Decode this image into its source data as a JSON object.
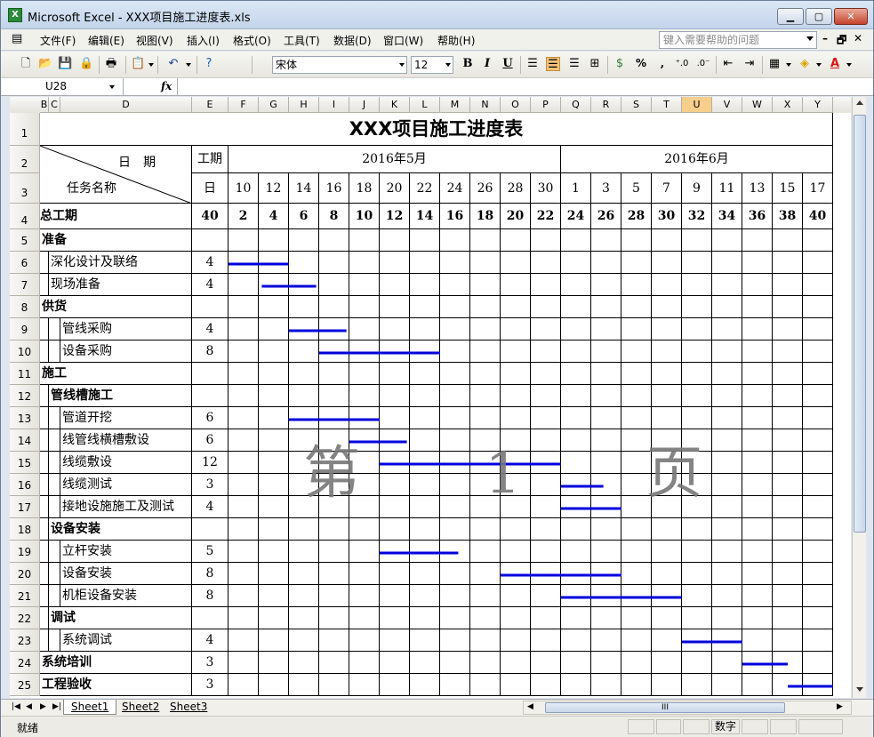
{
  "window": {
    "app_icon": "excel-icon",
    "title": "Microsoft Excel - XXX项目施工进度表.xls"
  },
  "menu": {
    "items": [
      "文件(F)",
      "编辑(E)",
      "视图(V)",
      "插入(I)",
      "格式(O)",
      "工具(T)",
      "数据(D)",
      "窗口(W)",
      "帮助(H)"
    ],
    "help_placeholder": "键入需要帮助的问题"
  },
  "toolbar": {
    "font_name": "宋体",
    "font_size": "12",
    "bold_label": "B",
    "italic_label": "I",
    "underline_label": "U",
    "percent_label": "%",
    "comma_label": ","
  },
  "formula_bar": {
    "cell_ref": "U28",
    "fx_label": "fx",
    "content": ""
  },
  "columns": [
    "B",
    "C",
    "D",
    "E",
    "F",
    "G",
    "H",
    "I",
    "J",
    "K",
    "L",
    "M",
    "N",
    "O",
    "P",
    "Q",
    "R",
    "S",
    "T",
    "U",
    "V",
    "W",
    "X",
    "Y"
  ],
  "selected_column": "U",
  "sheet": {
    "title": "XXX项目施工进度表",
    "date_header": "日　期",
    "task_header": "任务名称",
    "duration_header": "工期",
    "duration_unit": "日",
    "months": [
      "2016年5月",
      "2016年6月"
    ],
    "days": [
      "10",
      "12",
      "14",
      "16",
      "18",
      "20",
      "22",
      "24",
      "26",
      "28",
      "30",
      "1",
      "3",
      "5",
      "7",
      "9",
      "11",
      "13",
      "15",
      "17"
    ],
    "total_label": "总工期",
    "total_duration": "40",
    "cumulative": [
      "2",
      "4",
      "6",
      "8",
      "10",
      "12",
      "14",
      "16",
      "18",
      "20",
      "22",
      "24",
      "26",
      "28",
      "30",
      "32",
      "34",
      "36",
      "38",
      "40"
    ],
    "tasks": [
      {
        "row": "5",
        "name": "准备",
        "level": 0,
        "duration": ""
      },
      {
        "row": "6",
        "name": "深化设计及联络",
        "level": 1,
        "duration": "4"
      },
      {
        "row": "7",
        "name": "现场准备",
        "level": 1,
        "duration": "4"
      },
      {
        "row": "8",
        "name": "供货",
        "level": 0,
        "duration": ""
      },
      {
        "row": "9",
        "name": "管线采购",
        "level": 2,
        "duration": "4"
      },
      {
        "row": "10",
        "name": "设备采购",
        "level": 2,
        "duration": "8"
      },
      {
        "row": "11",
        "name": "施工",
        "level": 0,
        "duration": ""
      },
      {
        "row": "12",
        "name": "管线槽施工",
        "level": 1,
        "bold": true,
        "duration": ""
      },
      {
        "row": "13",
        "name": "管道开挖",
        "level": 2,
        "duration": "6"
      },
      {
        "row": "14",
        "name": "线管线横槽敷设",
        "level": 2,
        "duration": "6"
      },
      {
        "row": "15",
        "name": "线缆敷设",
        "level": 2,
        "duration": "12"
      },
      {
        "row": "16",
        "name": "线缆测试",
        "level": 2,
        "duration": "3"
      },
      {
        "row": "17",
        "name": "接地设施施工及测试",
        "level": 2,
        "duration": "4"
      },
      {
        "row": "18",
        "name": "设备安装",
        "level": 1,
        "bold": true,
        "duration": ""
      },
      {
        "row": "19",
        "name": "立杆安装",
        "level": 2,
        "duration": "5"
      },
      {
        "row": "20",
        "name": "设备安装",
        "level": 2,
        "duration": "8"
      },
      {
        "row": "21",
        "name": "机柜设备安装",
        "level": 2,
        "duration": "8"
      },
      {
        "row": "22",
        "name": "调试",
        "level": 1,
        "bold": true,
        "duration": ""
      },
      {
        "row": "23",
        "name": "系统调试",
        "level": 2,
        "duration": "4"
      },
      {
        "row": "24",
        "name": "系统培训",
        "level": 0,
        "duration": "3"
      },
      {
        "row": "25",
        "name": "工程验收",
        "level": 0,
        "duration": "3"
      }
    ],
    "header_rows": [
      "1",
      "2",
      "3",
      "4"
    ],
    "watermark": "第 1 页"
  },
  "gantt_bars": [
    {
      "row": "6",
      "start_day": 0.0,
      "end_day": 4.0
    },
    {
      "row": "7",
      "start_day": 2.2,
      "end_day": 5.8
    },
    {
      "row": "9",
      "start_day": 4.0,
      "end_day": 7.8
    },
    {
      "row": "10",
      "start_day": 6.0,
      "end_day": 14.0
    },
    {
      "row": "13",
      "start_day": 4.0,
      "end_day": 10.0
    },
    {
      "row": "14",
      "start_day": 8.0,
      "end_day": 11.8
    },
    {
      "row": "15",
      "start_day": 10.0,
      "end_day": 22.0
    },
    {
      "row": "16",
      "start_day": 22.0,
      "end_day": 24.8
    },
    {
      "row": "17",
      "start_day": 22.0,
      "end_day": 26.0
    },
    {
      "row": "19",
      "start_day": 10.0,
      "end_day": 15.2
    },
    {
      "row": "20",
      "start_day": 18.0,
      "end_day": 26.0
    },
    {
      "row": "21",
      "start_day": 22.0,
      "end_day": 30.0
    },
    {
      "row": "23",
      "start_day": 30.0,
      "end_day": 34.0
    },
    {
      "row": "24",
      "start_day": 34.0,
      "end_day": 37.0
    },
    {
      "row": "25",
      "start_day": 37.0,
      "end_day": 40.0
    }
  ],
  "sheet_tabs": [
    "Sheet1",
    "Sheet2",
    "Sheet3"
  ],
  "status": {
    "text": "就绪",
    "mode": "数字"
  },
  "colors": {
    "gantt_bar": "#0000dd",
    "selected_header": "#f8ce8d"
  }
}
